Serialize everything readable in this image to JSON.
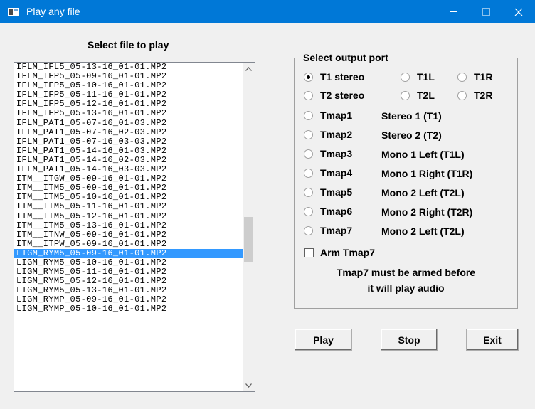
{
  "window": {
    "title": "Play any file"
  },
  "file_list": {
    "heading": "Select file to play",
    "items": [
      "IFLM_IFL5_05-13-16_01-01.MP2",
      "IFLM_IFP5_05-09-16_01-01.MP2",
      "IFLM_IFP5_05-10-16_01-01.MP2",
      "IFLM_IFP5_05-11-16_01-01.MP2",
      "IFLM_IFP5_05-12-16_01-01.MP2",
      "IFLM_IFP5_05-13-16_01-01.MP2",
      "IFLM_PAT1_05-07-16_01-03.MP2",
      "IFLM_PAT1_05-07-16_02-03.MP2",
      "IFLM_PAT1_05-07-16_03-03.MP2",
      "IFLM_PAT1_05-14-16_01-03.MP2",
      "IFLM_PAT1_05-14-16_02-03.MP2",
      "IFLM_PAT1_05-14-16_03-03.MP2",
      "ITM__ITGW_05-09-16_01-01.MP2",
      "ITM__ITM5_05-09-16_01-01.MP2",
      "ITM__ITM5_05-10-16_01-01.MP2",
      "ITM__ITM5_05-11-16_01-01.MP2",
      "ITM__ITM5_05-12-16_01-01.MP2",
      "ITM__ITM5_05-13-16_01-01.MP2",
      "ITM__ITNW_05-09-16_01-01.MP2",
      "ITM__ITPW_05-09-16_01-01.MP2",
      "LIGM_RYM5_05-09-16_01-01.MP2",
      "LIGM_RYM5_05-10-16_01-01.MP2",
      "LIGM_RYM5_05-11-16_01-01.MP2",
      "LIGM_RYM5_05-12-16_01-01.MP2",
      "LIGM_RYM5_05-13-16_01-01.MP2",
      "LIGM_RYMP_05-09-16_01-01.MP2",
      "LIGM_RYMP_05-10-16_01-01.MP2"
    ],
    "selected_item": "LIGM_RYM5_05-09-16_01-01.MP2",
    "scroll_fraction": 0.55
  },
  "output_port": {
    "group_title": "Select output port",
    "options": {
      "t1_stereo": "T1 stereo",
      "t1l": "T1L",
      "t1r": "T1R",
      "t2_stereo": "T2 stereo",
      "t2l": "T2L",
      "t2r": "T2R",
      "tmap1": "Tmap1",
      "tmap2": "Tmap2",
      "tmap3": "Tmap3",
      "tmap4": "Tmap4",
      "tmap5": "Tmap5",
      "tmap6": "Tmap6",
      "tmap7": "Tmap7"
    },
    "descriptions": {
      "tmap1": "Stereo 1 (T1)",
      "tmap2": "Stereo 2 (T2)",
      "tmap3": "Mono 1 Left (T1L)",
      "tmap4": "Mono 1 Right (T1R)",
      "tmap5": "Mono 2 Left (T2L)",
      "tmap6": "Mono 2 Right (T2R)",
      "tmap7": "Mono 2 Left (T2L)"
    },
    "selected": "T1 stereo",
    "arm_label": "Arm Tmap7",
    "arm_checked": false,
    "note_line1": "Tmap7 must be armed before",
    "note_line2": "it will play audio"
  },
  "buttons": {
    "play": "Play",
    "stop": "Stop",
    "exit": "Exit"
  },
  "colors": {
    "titlebar": "#0078d7",
    "selection": "#3399ff",
    "window_bg": "#f0f0f0"
  }
}
